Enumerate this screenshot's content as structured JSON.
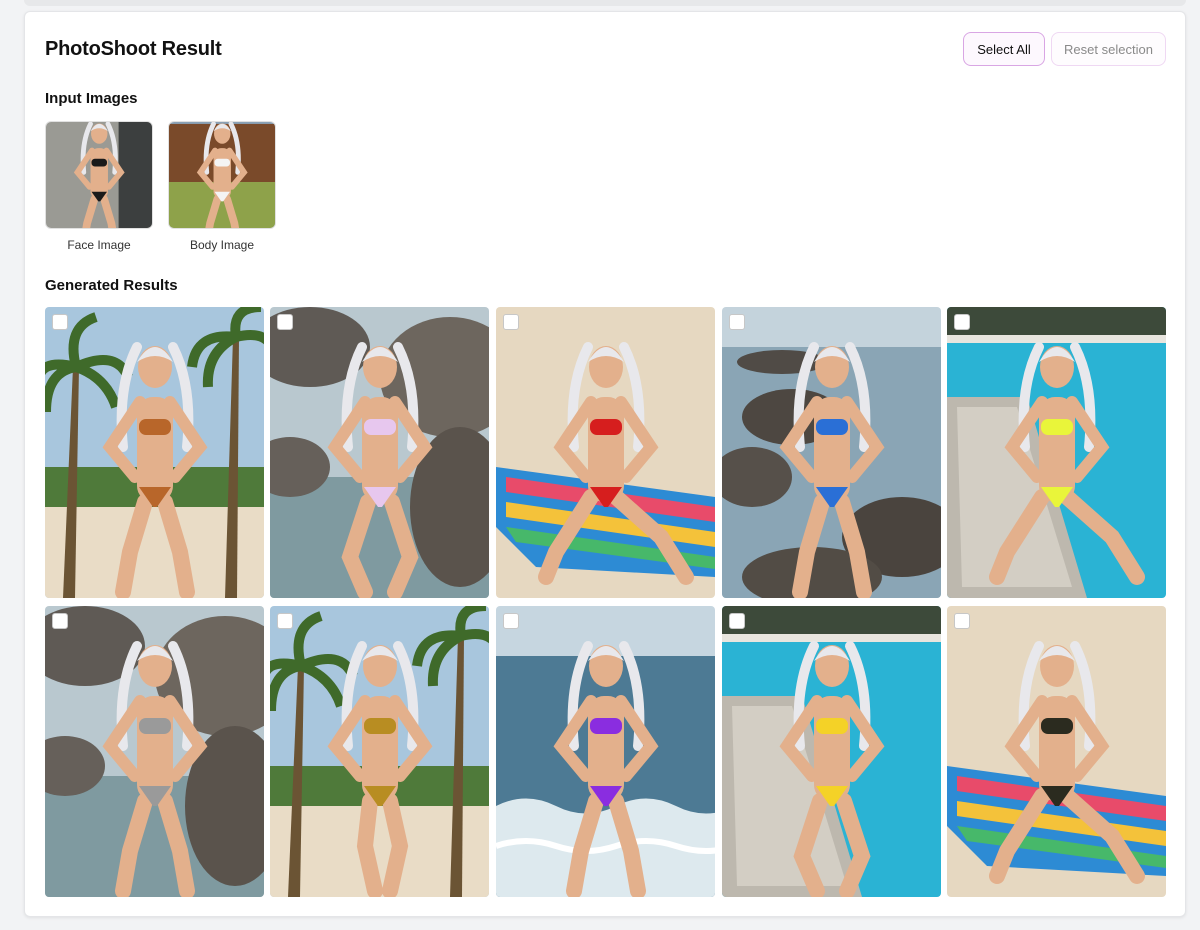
{
  "header": {
    "title": "PhotoShoot Result",
    "select_all_label": "Select All",
    "reset_label": "Reset selection"
  },
  "inputs": {
    "section_title": "Input Images",
    "items": [
      {
        "caption": "Face Image",
        "scene": "portrait",
        "top_color": "#1a1a1a"
      },
      {
        "caption": "Body Image",
        "scene": "garden",
        "top_color": "#f4f4f4"
      }
    ]
  },
  "results": {
    "section_title": "Generated Results",
    "items": [
      {
        "scene": "beach-palms",
        "swimsuit": "#b8662a",
        "pose": "standing",
        "checked": false
      },
      {
        "scene": "rocks-water",
        "swimsuit": "#e7c7ee",
        "pose": "kneeling",
        "checked": false
      },
      {
        "scene": "sand-towel",
        "swimsuit": "#d61e1e",
        "pose": "sitting",
        "checked": false
      },
      {
        "scene": "rocks-ocean",
        "swimsuit": "#2a6fd6",
        "pose": "standing",
        "checked": false
      },
      {
        "scene": "pool-lounger",
        "swimsuit": "#e9f53a",
        "pose": "sitting",
        "checked": false
      },
      {
        "scene": "rocks-water",
        "swimsuit": "#9a9a9a",
        "pose": "standing",
        "checked": false
      },
      {
        "scene": "beach-palms",
        "swimsuit": "#b88d22",
        "pose": "walking",
        "checked": false
      },
      {
        "scene": "ocean-waves",
        "swimsuit": "#8a2de0",
        "pose": "standing",
        "checked": false
      },
      {
        "scene": "pool-lounger",
        "swimsuit": "#f4d227",
        "pose": "kneeling",
        "checked": false
      },
      {
        "scene": "sand-towel",
        "swimsuit": "#2b2b1f",
        "pose": "sitting",
        "checked": false
      }
    ]
  }
}
